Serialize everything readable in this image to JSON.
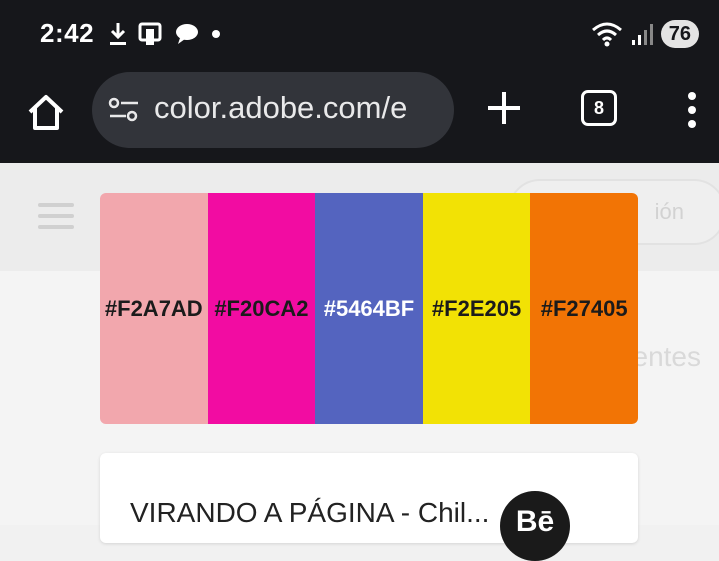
{
  "status_bar": {
    "time": "2:42",
    "battery": "76"
  },
  "browser": {
    "url": "color.adobe.com/e",
    "tab_count": "8"
  },
  "page": {
    "header_pill_text": "ión",
    "background_text": "entes",
    "palette": {
      "swatches": [
        {
          "hex": "#F2A7AD",
          "color": "#F2A7AD",
          "text_color": "#1b1b1b"
        },
        {
          "hex": "#F20CA2",
          "color": "#F20CA2",
          "text_color": "#1b1b1b"
        },
        {
          "hex": "#5464BF",
          "color": "#5464BF",
          "text_color": "#ffffff"
        },
        {
          "hex": "#F2E205",
          "color": "#F2E205",
          "text_color": "#1b1b1b"
        },
        {
          "hex": "#F27405",
          "color": "#F27405",
          "text_color": "#1b1b1b"
        }
      ]
    },
    "card": {
      "title": "VIRANDO A PÁGINA - Chil...",
      "badge": "Bē"
    }
  }
}
